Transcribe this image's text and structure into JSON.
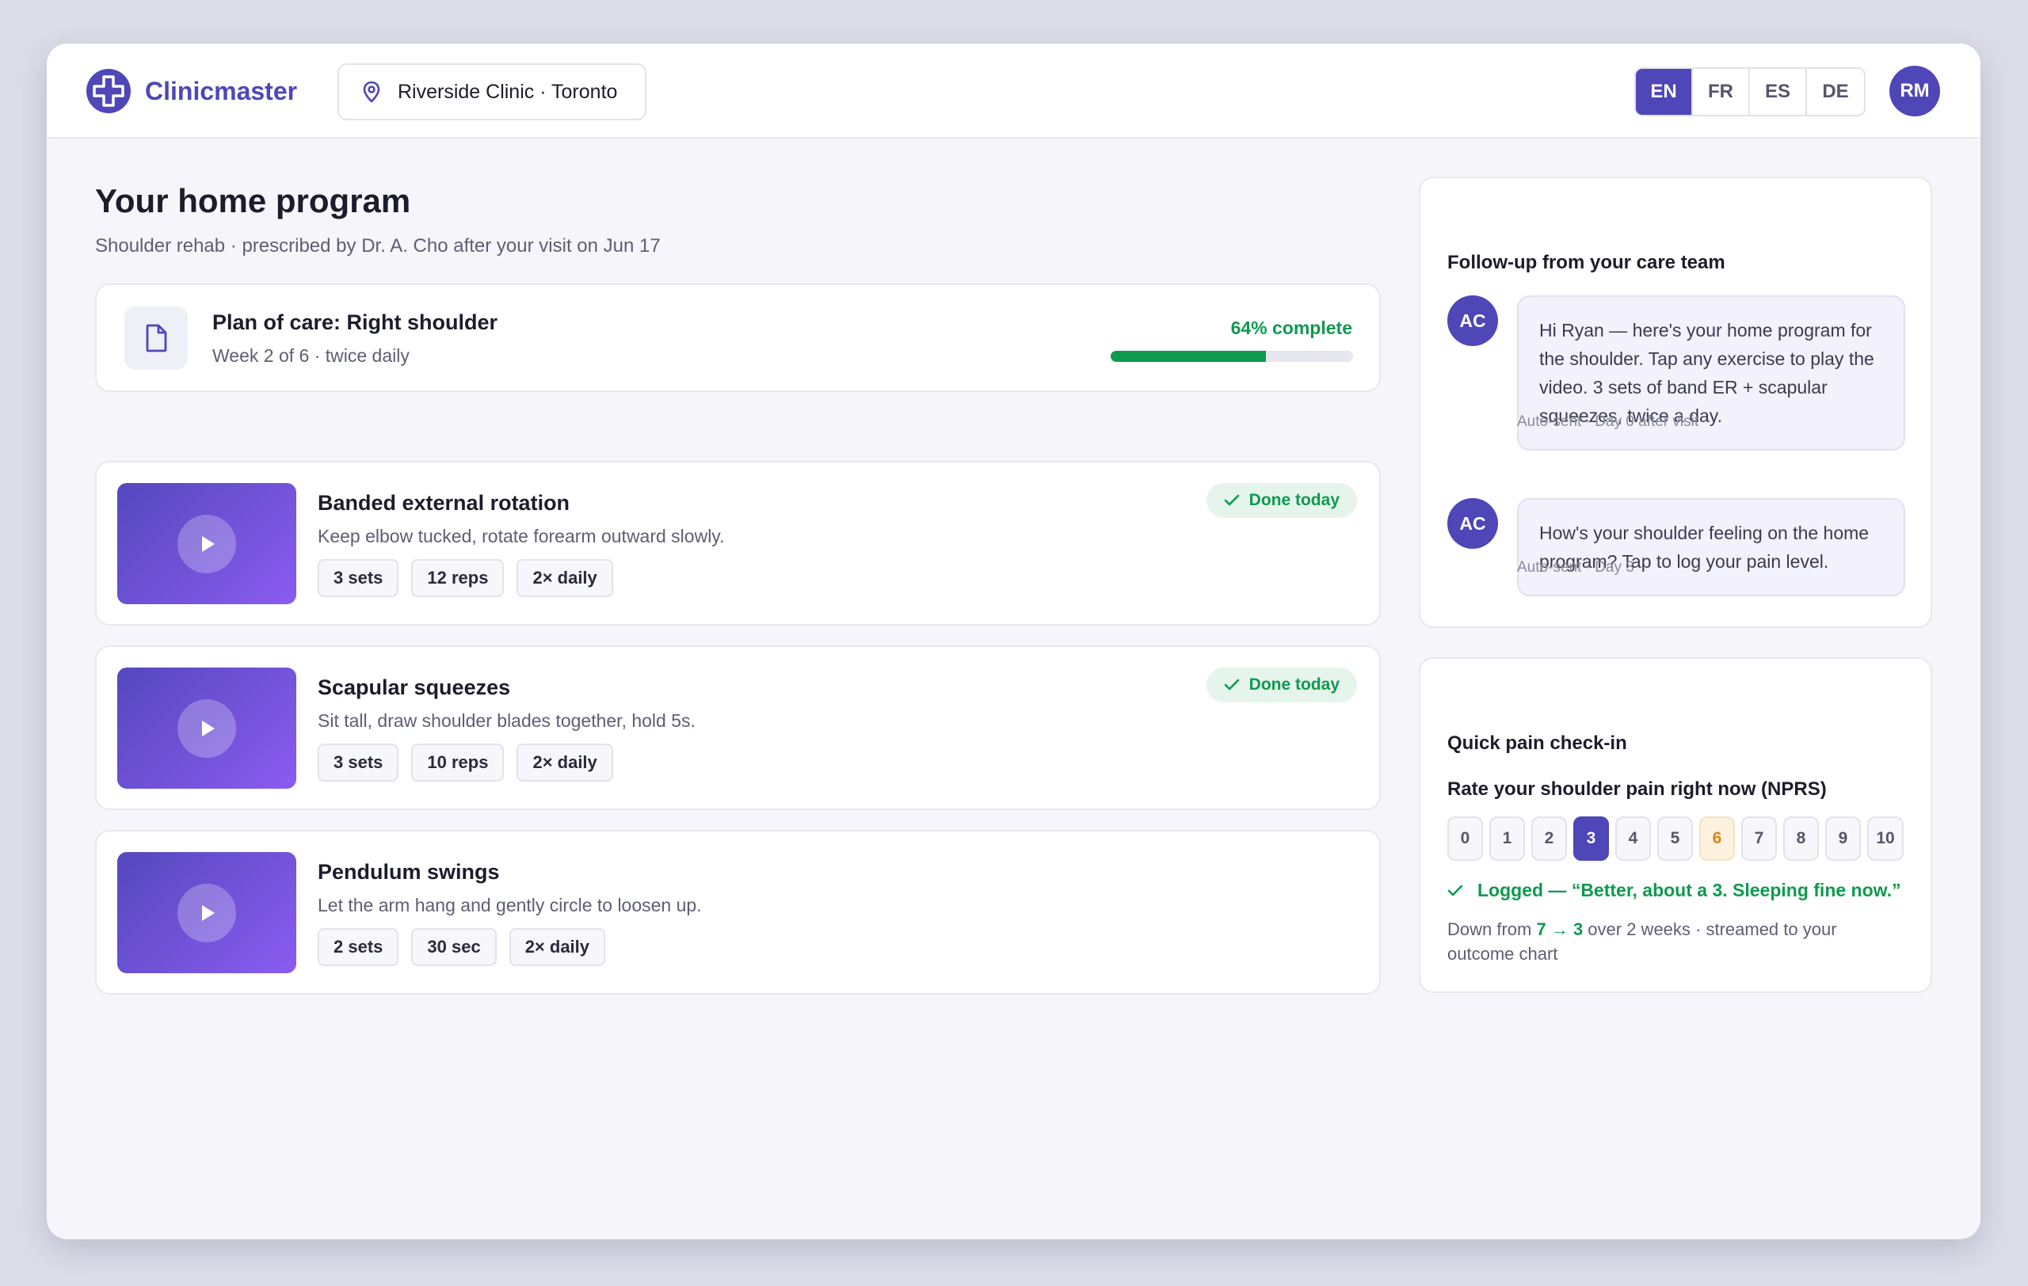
{
  "brand": {
    "name": "Clinicmaster",
    "color": "#4f46b8",
    "icon": "cross-logo-icon"
  },
  "clinic": {
    "label": "Riverside Clinic · Toronto",
    "icon": "location-pin-icon"
  },
  "languages": [
    {
      "code": "EN",
      "active": true
    },
    {
      "code": "FR",
      "active": false
    },
    {
      "code": "ES",
      "active": false
    },
    {
      "code": "DE",
      "active": false
    }
  ],
  "user": {
    "initials": "RM"
  },
  "page": {
    "title": "Your home program",
    "subtitle": "Shoulder rehab · prescribed by Dr. A. Cho after your visit on Jun 17"
  },
  "plan": {
    "title": "Plan of care: Right shoulder",
    "subtitle": "Week 2 of 6 · twice daily",
    "progress_label": "64% complete",
    "progress_fraction": 0.64,
    "icon": "document-icon",
    "progress_color": "#0e9a4f"
  },
  "exercises": [
    {
      "title": "Banded external rotation",
      "description": "Keep elbow tucked, rotate forearm outward slowly.",
      "chips": [
        "3 sets",
        "12 reps",
        "2× daily"
      ],
      "done": true,
      "done_label": "Done today"
    },
    {
      "title": "Scapular squeezes",
      "description": "Sit tall, draw shoulder blades together, hold 5s.",
      "chips": [
        "3 sets",
        "10 reps",
        "2× daily"
      ],
      "done": true,
      "done_label": "Done today"
    },
    {
      "title": "Pendulum swings",
      "description": "Let the arm hang and gently circle to loosen up.",
      "chips": [
        "2 sets",
        "30 sec",
        "2× daily"
      ],
      "done": false,
      "done_label": ""
    }
  ],
  "followup": {
    "title": "Follow-up from your care team",
    "messages": [
      {
        "initials": "AC",
        "text": "Hi Ryan — here's your home program for the shoulder. Tap any exercise to play the video. 3 sets of band ER + scapular squeezes, twice a day.",
        "meta": "Auto-sent · Day 0 after visit"
      },
      {
        "initials": "AC",
        "text": "How's your shoulder feeling on the home program? Tap to log your pain level.",
        "meta": "Auto-sent · Day 3"
      }
    ]
  },
  "pain": {
    "title": "Quick pain check-in",
    "question": "Rate your shoulder pain right now (NPRS)",
    "scale": [
      "0",
      "1",
      "2",
      "3",
      "4",
      "5",
      "6",
      "7",
      "8",
      "9",
      "10"
    ],
    "selected": "3",
    "previous": "6",
    "logged": "Logged — “Better, about a 3. Sleeping fine now.”",
    "trend_prefix": "Down from ",
    "trend_change": "7 → 3",
    "trend_suffix": " over 2 weeks · streamed to your outcome chart",
    "success_color": "#0e9a4f",
    "previous_color": "#d98616"
  }
}
